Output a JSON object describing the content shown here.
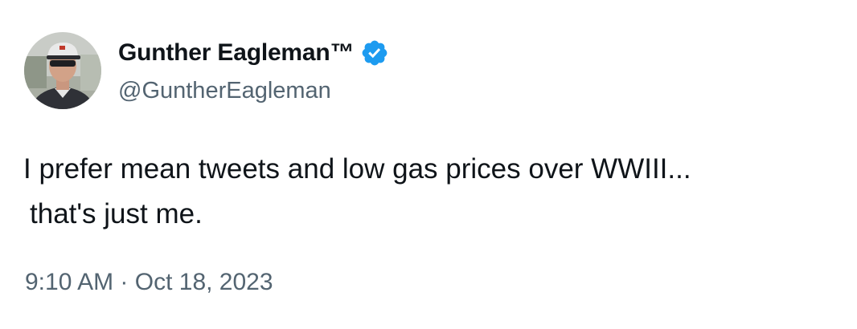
{
  "author": {
    "display_name": "Gunther Eagleman™",
    "handle": "@GuntherEagleman",
    "verified_icon": "verified-badge-icon"
  },
  "tweet": {
    "text_line_1": "I prefer mean tweets and low gas prices over WWIII...",
    "text_line_2": "that's just me."
  },
  "meta": {
    "time": "9:10 AM",
    "separator": "·",
    "date": "Oct 18, 2023"
  },
  "colors": {
    "text": "#0f1419",
    "secondary": "#536471",
    "verified": "#1d9bf0"
  }
}
